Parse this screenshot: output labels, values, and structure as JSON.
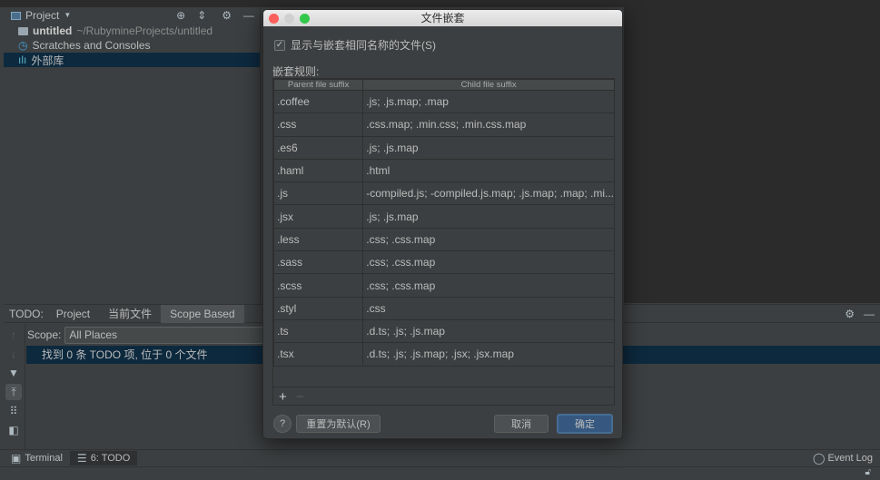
{
  "project": {
    "title": "Project",
    "items": [
      {
        "name": "untitled",
        "path": "~/RubymineProjects/untitled"
      },
      {
        "name": "Scratches and Consoles"
      },
      {
        "name": "外部库"
      }
    ]
  },
  "todo": {
    "label": "TODO:",
    "tabs": [
      "Project",
      "当前文件",
      "Scope Based"
    ],
    "active_tab": "Scope Based",
    "scope_label": "Scope:",
    "scope_value": "All Places",
    "result": "找到 0 条 TODO 项, 位于 0 个文件"
  },
  "bottom": {
    "terminal": "Terminal",
    "todo": "6: TODO",
    "event_log": "Event Log"
  },
  "dialog": {
    "title": "文件嵌套",
    "checkbox_label": "显示与嵌套相同名称的文件(S)",
    "checkbox_checked": true,
    "rules_label": "嵌套规则:",
    "columns": [
      "Parent file suffix",
      "Child file suffix"
    ],
    "rows": [
      [
        ".coffee",
        ".js; .js.map; .map"
      ],
      [
        ".css",
        ".css.map; .min.css; .min.css.map"
      ],
      [
        ".es6",
        ".js; .js.map"
      ],
      [
        ".haml",
        ".html"
      ],
      [
        ".js",
        "-compiled.js; -compiled.js.map; .js.map; .map; .mi..."
      ],
      [
        ".jsx",
        ".js; .js.map"
      ],
      [
        ".less",
        ".css; .css.map"
      ],
      [
        ".sass",
        ".css; .css.map"
      ],
      [
        ".scss",
        ".css; .css.map"
      ],
      [
        ".styl",
        ".css"
      ],
      [
        ".ts",
        ".d.ts; .js; .js.map"
      ],
      [
        ".tsx",
        ".d.ts; .js; .js.map; .jsx; .jsx.map"
      ]
    ],
    "add": "+",
    "remove": "−",
    "help": "?",
    "reset": "重置为默认(R)",
    "cancel": "取消",
    "ok": "确定"
  },
  "colors": {
    "selection": "#0d293e",
    "primary_button": "#365880"
  }
}
